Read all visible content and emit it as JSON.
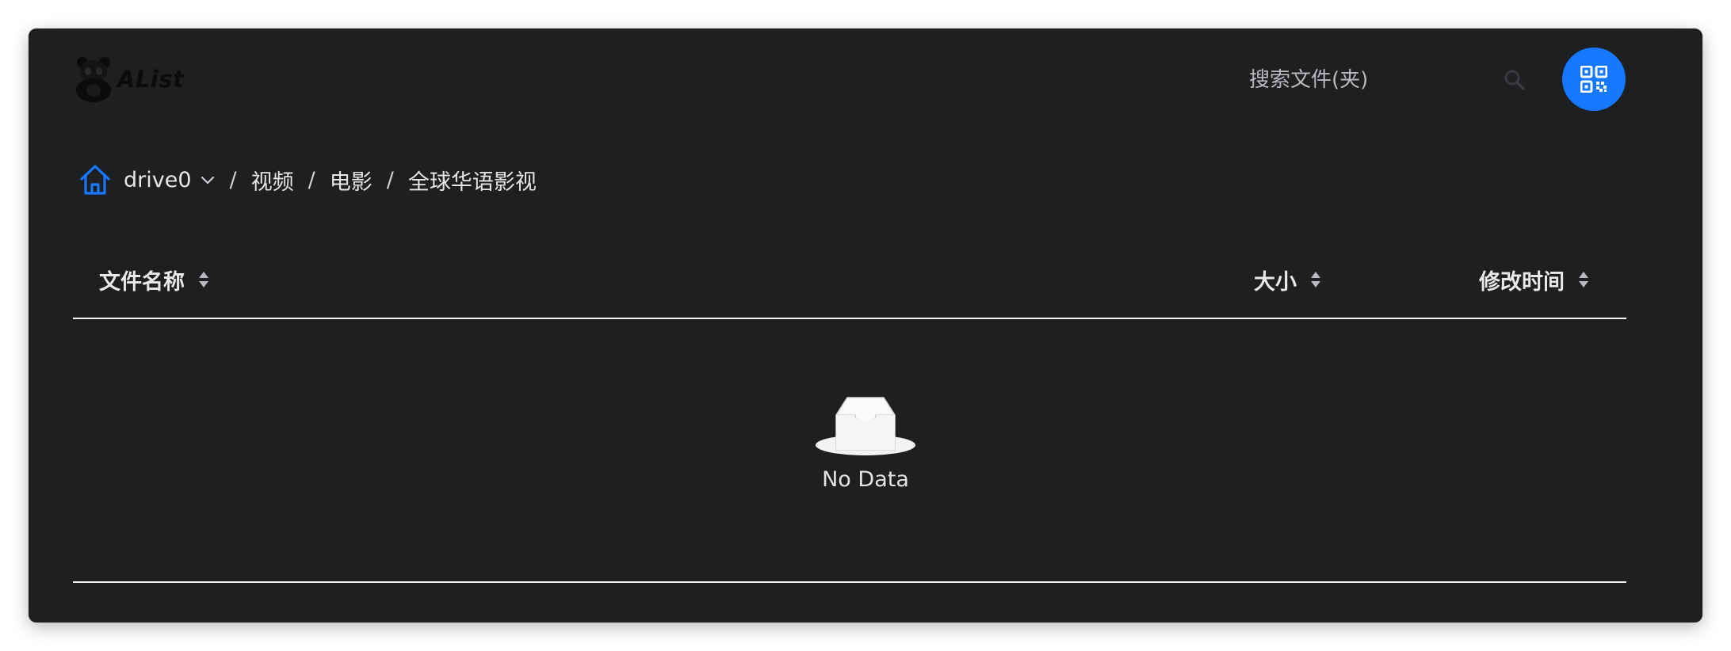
{
  "app": {
    "logo_text": "AList"
  },
  "search": {
    "placeholder": "搜索文件(夹)"
  },
  "breadcrumb": {
    "items": [
      "drive0",
      "视频",
      "电影",
      "全球华语影视"
    ],
    "separator": "/"
  },
  "table": {
    "columns": [
      "文件名称",
      "大小",
      "修改时间"
    ],
    "empty_text": "No Data"
  },
  "colors": {
    "accent": "#1677ff",
    "background": "#1e1f21",
    "text": "#e6e6e8"
  },
  "icons": [
    "panda-logo-icon",
    "search-icon",
    "qr-code-icon",
    "home-icon",
    "chevron-down-icon",
    "sort-icon",
    "empty-inbox-icon"
  ]
}
